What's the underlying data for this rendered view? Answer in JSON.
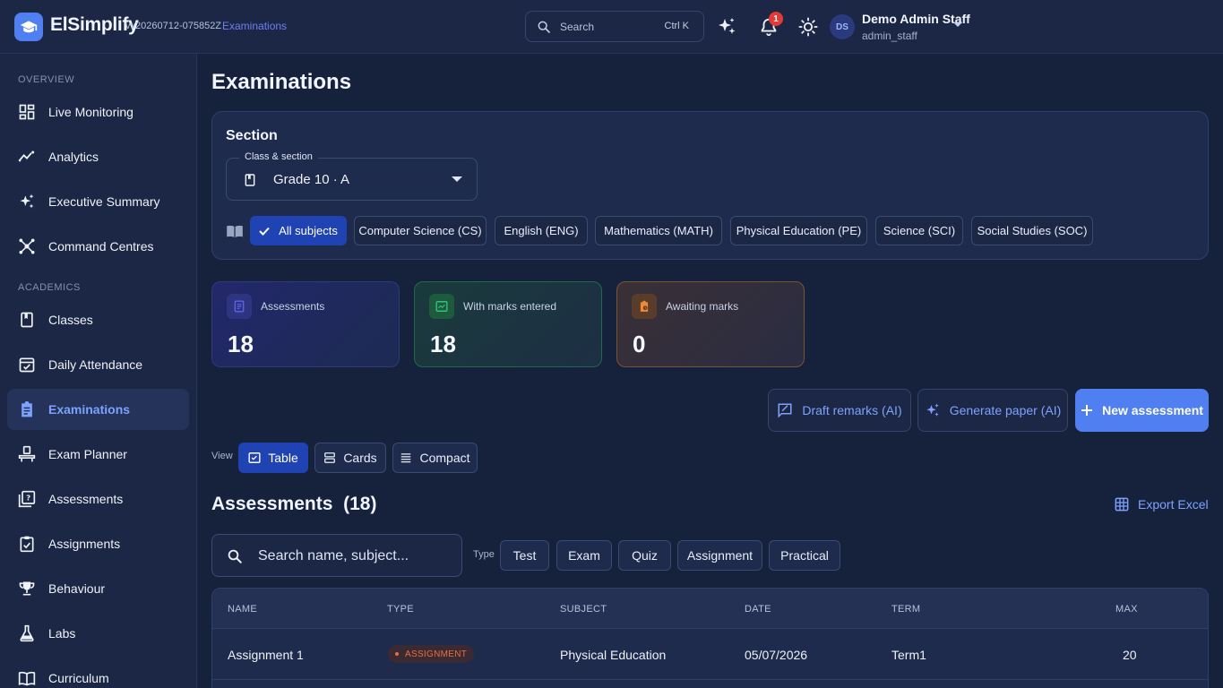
{
  "header": {
    "app_name": "ElSimplify",
    "version": "vv20260712-075852Z",
    "breadcrumb": "Examinations",
    "search": {
      "placeholder": "Search",
      "shortcut": "Ctrl K"
    },
    "notification_count": "1",
    "user": {
      "initials": "DS",
      "name": "Demo Admin Staff",
      "role": "admin_staff"
    }
  },
  "sidebar": {
    "sections": [
      {
        "title": "OVERVIEW"
      },
      {
        "title": "ACADEMICS"
      }
    ],
    "items": [
      {
        "label": "Live Monitoring",
        "icon": "dashboard-icon"
      },
      {
        "label": "Analytics",
        "icon": "trend-icon"
      },
      {
        "label": "Executive Summary",
        "icon": "sparkle-icon"
      },
      {
        "label": "Command Centres",
        "icon": "hub-icon"
      },
      {
        "label": "Classes",
        "icon": "book-icon"
      },
      {
        "label": "Daily Attendance",
        "icon": "attendance-icon"
      },
      {
        "label": "Examinations",
        "icon": "clipboard-icon",
        "active": true
      },
      {
        "label": "Exam Planner",
        "icon": "planner-icon"
      },
      {
        "label": "Assessments",
        "icon": "quiz-icon"
      },
      {
        "label": "Assignments",
        "icon": "assignment-icon"
      },
      {
        "label": "Behaviour",
        "icon": "trophy-icon"
      },
      {
        "label": "Labs",
        "icon": "flask-icon"
      },
      {
        "label": "Curriculum",
        "icon": "open-book-icon"
      }
    ]
  },
  "main": {
    "title": "Examinations",
    "section": {
      "title": "Section",
      "select_label": "Class & section",
      "select_value": "Grade 10 · A",
      "subjects": [
        "All subjects",
        "Computer Science (CS)",
        "English (ENG)",
        "Mathematics (MATH)",
        "Physical Education (PE)",
        "Science (SCI)",
        "Social Studies (SOC)"
      ],
      "selected_subject": "All subjects"
    },
    "stats": [
      {
        "label": "Assessments",
        "value": "18"
      },
      {
        "label": "With marks entered",
        "value": "18"
      },
      {
        "label": "Awaiting marks",
        "value": "0"
      }
    ],
    "actions": {
      "draft_remarks": "Draft remarks (AI)",
      "generate_paper": "Generate paper (AI)",
      "new_assessment": "New assessment"
    },
    "view": {
      "label": "View",
      "options": [
        "Table",
        "Cards",
        "Compact"
      ],
      "selected": "Table"
    },
    "list": {
      "title": "Assessments",
      "count": "(18)",
      "export_label": "Export Excel",
      "search_placeholder": "Search name, subject...",
      "type_label": "Type",
      "types": [
        "Test",
        "Exam",
        "Quiz",
        "Assignment",
        "Practical"
      ]
    },
    "table": {
      "columns": [
        "NAME",
        "TYPE",
        "SUBJECT",
        "DATE",
        "TERM",
        "MAX"
      ],
      "rows": [
        {
          "name": "Assignment 1",
          "type": "ASSIGNMENT",
          "subject": "Physical Education",
          "date": "05/07/2026",
          "term": "Term1",
          "max": "20"
        }
      ]
    }
  },
  "colors": {
    "accent": "#4f7ff0",
    "selected_chip": "#1f43b3",
    "background": "#16213c",
    "assignment_type": "#ec6d3c",
    "badge_red": "#e53935"
  }
}
